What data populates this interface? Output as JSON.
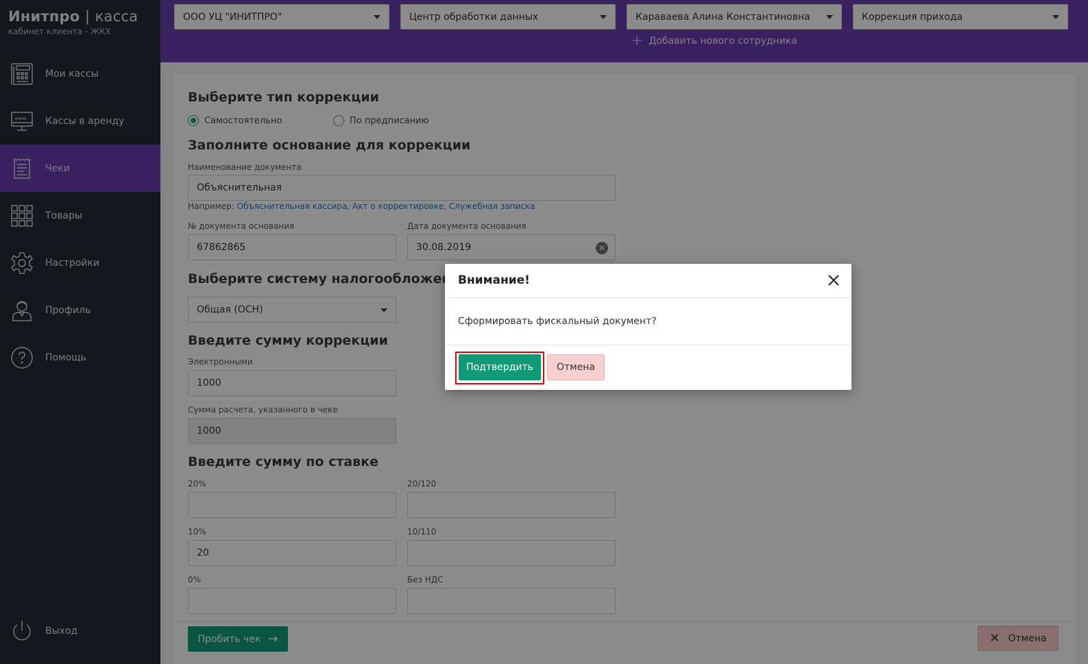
{
  "brand": {
    "name": "Инитпро",
    "separator": "|",
    "product": "касса",
    "subtitle": "кабинет клиента - ЖКХ"
  },
  "sidebar": {
    "items": [
      {
        "label": "Мои кассы",
        "icon": "cash-register-icon"
      },
      {
        "label": "Кассы в аренду",
        "icon": "www-monitor-icon"
      },
      {
        "label": "Чеки",
        "icon": "receipt-icon",
        "active": true
      },
      {
        "label": "Товары",
        "icon": "grid-icon"
      },
      {
        "label": "Настройки",
        "icon": "gear-icon"
      },
      {
        "label": "Профиль",
        "icon": "user-icon"
      },
      {
        "label": "Помощь",
        "icon": "help-icon"
      }
    ],
    "logout": {
      "label": "Выход",
      "icon": "power-icon"
    }
  },
  "header": {
    "org": "ООО УЦ \"ИНИТПРО\"",
    "department": "Центр обработки данных",
    "employee": "Караваева Алина Константиновна",
    "operation": "Коррекция прихода",
    "add_employee": "Добавить нового сотрудника"
  },
  "form": {
    "section_type": "Выберите тип коррекции",
    "radio_self": "Самостоятельно",
    "radio_order": "По предписанию",
    "section_basis": "Заполните основание для коррекции",
    "doc_name_label": "Наименование документа",
    "doc_name_value": "Объяснительная",
    "hint_prefix": "Например:",
    "hint_links": [
      "Объяснительная кассира",
      "Акт о корректировке",
      "Служебная записка"
    ],
    "hint_sep": ",",
    "doc_number_label": "№ документа основания",
    "doc_number_value": "67862865",
    "doc_date_label": "Дата документа основания",
    "doc_date_value": "30.08.2019",
    "section_tax": "Выберите систему налогообложения",
    "tax_value": "Общая (ОСН)",
    "section_sum": "Введите сумму коррекции",
    "electronic_label": "Электронными",
    "electronic_value": "1000",
    "check_sum_label": "Сумма расчета, указанного в чеке",
    "check_sum_value": "1000",
    "section_rate": "Введите сумму по ставке",
    "rate_20_label": "20%",
    "rate_20_value": "",
    "rate_20_120_label": "20/120",
    "rate_20_120_value": "",
    "rate_10_label": "10%",
    "rate_10_value": "20",
    "rate_10_110_label": "10/110",
    "rate_10_110_value": "",
    "rate_0_label": "0%",
    "rate_0_value": "",
    "no_vat_label": "Без НДС",
    "no_vat_value": ""
  },
  "actions": {
    "print": "Пробить чек",
    "cancel": "Отмена"
  },
  "modal": {
    "title": "Внимание!",
    "message": "Сформировать фискальный документ?",
    "confirm": "Подтвердить",
    "cancel": "Отмена"
  },
  "colors": {
    "purple": "#6a3fb1",
    "sidebar": "#262a33",
    "green": "#0f9b78",
    "pink": "#f9d0d0",
    "highlight": "#e00000"
  }
}
